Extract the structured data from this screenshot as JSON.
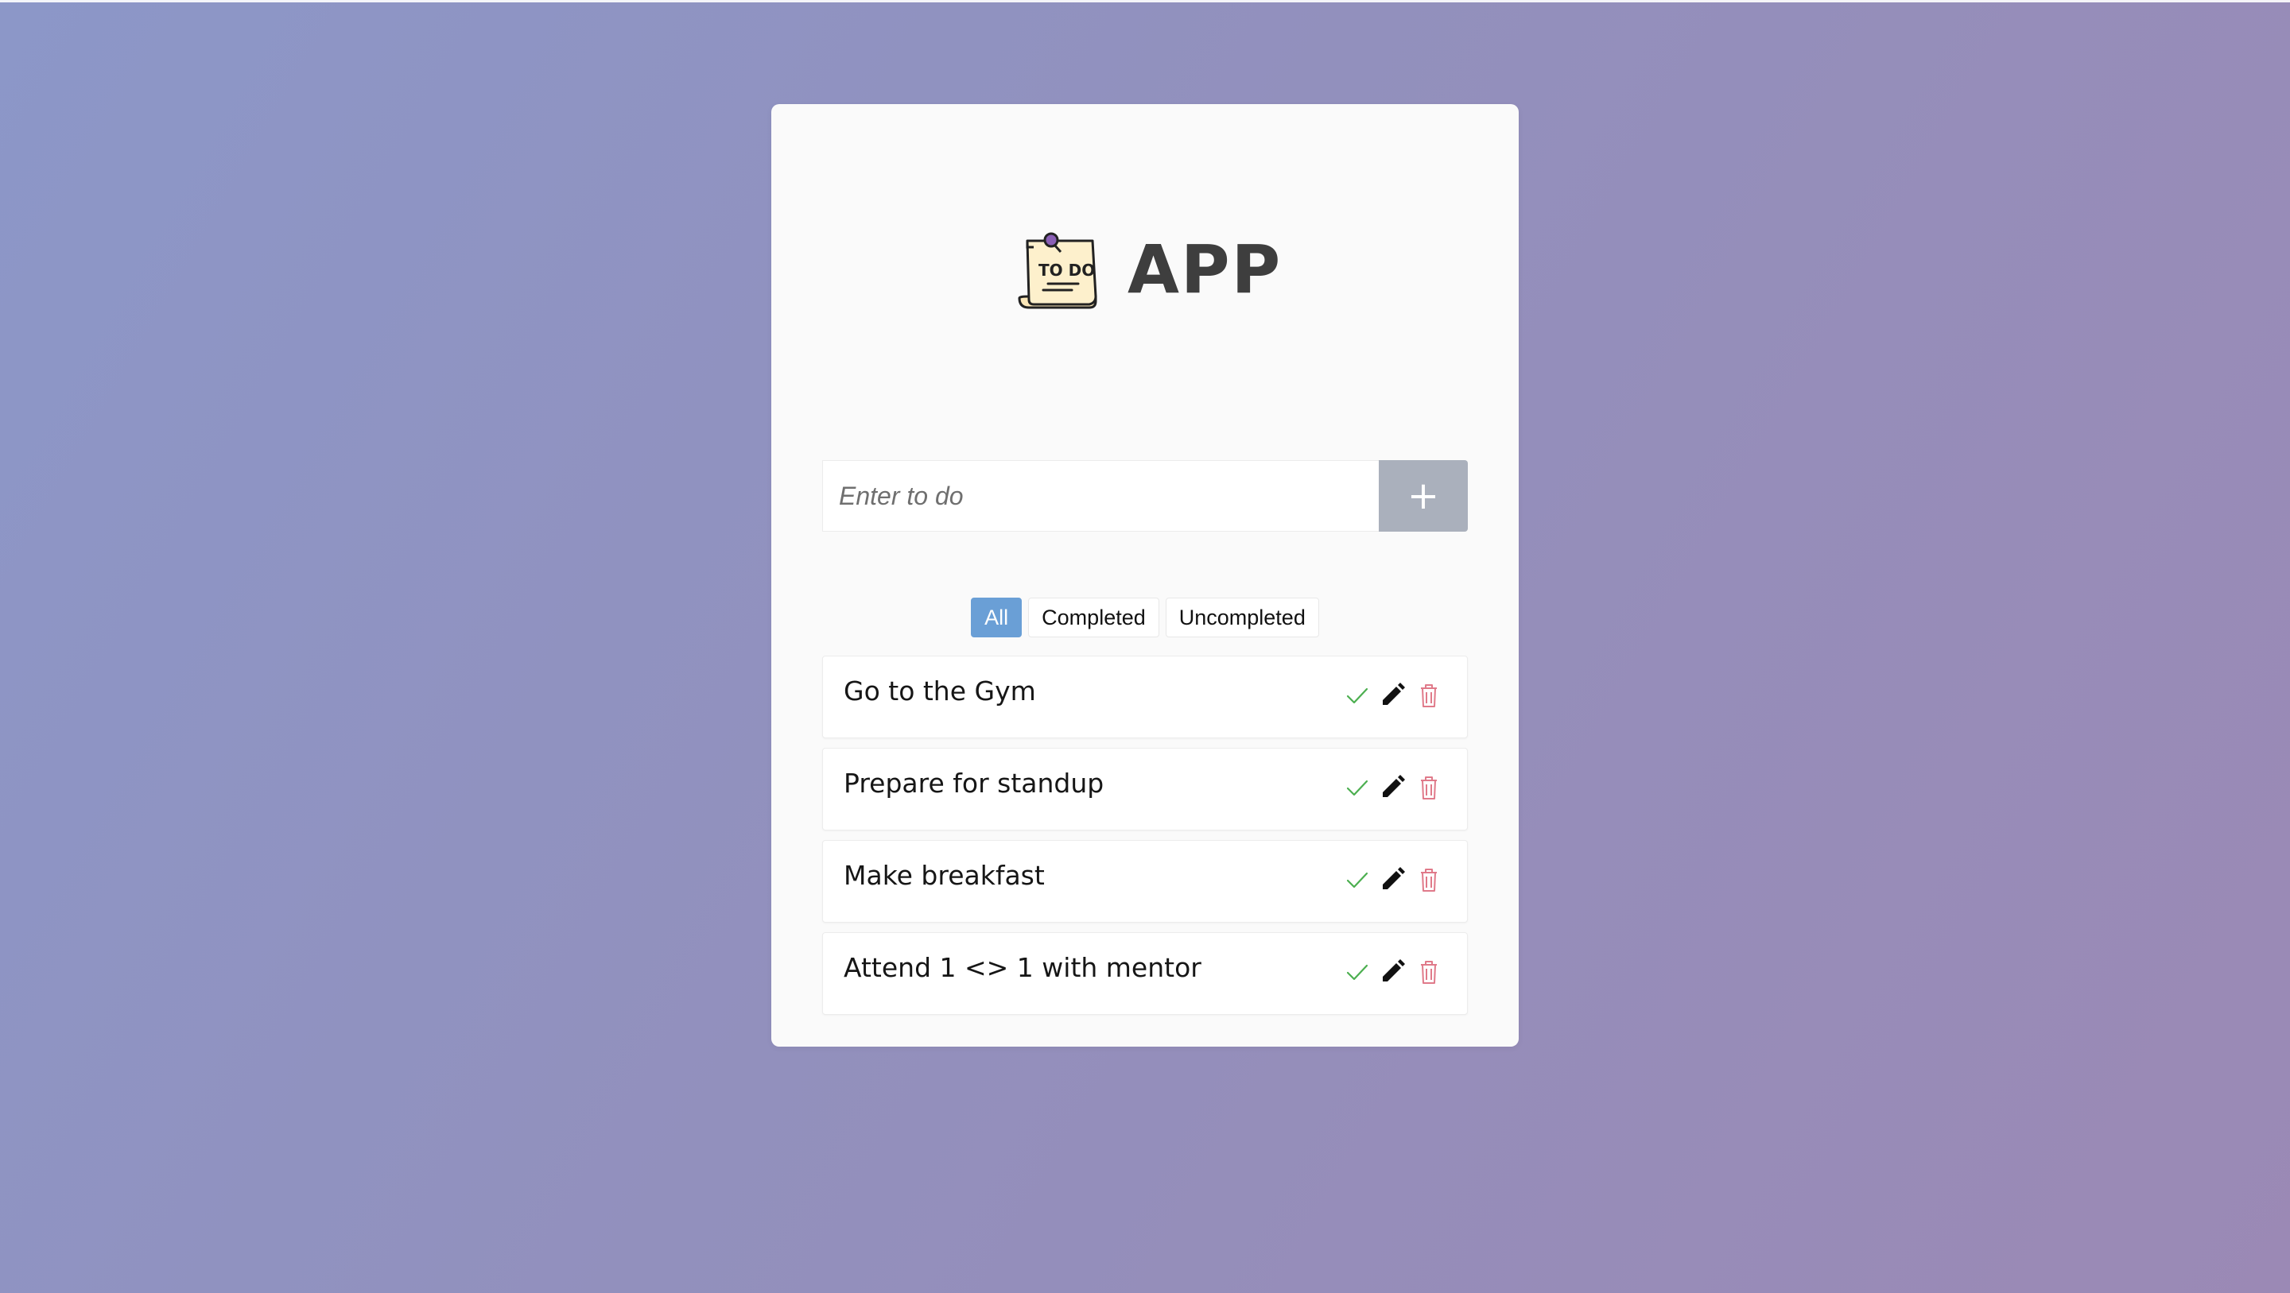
{
  "app": {
    "title": "APP",
    "logo_text": "TO DO"
  },
  "input": {
    "placeholder": "Enter to do",
    "value": "",
    "add_label": "+"
  },
  "filters": {
    "items": [
      "All",
      "Completed",
      "Uncompleted"
    ],
    "active": "All"
  },
  "todos": [
    {
      "text": "Go to the Gym"
    },
    {
      "text": "Prepare for standup"
    },
    {
      "text": "Make breakfast"
    },
    {
      "text": "Attend 1 <> 1 with mentor"
    }
  ],
  "icons": {
    "complete": "check-icon",
    "edit": "pencil-icon",
    "delete": "trash-icon"
  },
  "colors": {
    "check": "#4caf50",
    "pencil": "#111111",
    "trash": "#e07a8a",
    "active_filter": "#6a9fd6",
    "add_button": "#aab0bc"
  }
}
